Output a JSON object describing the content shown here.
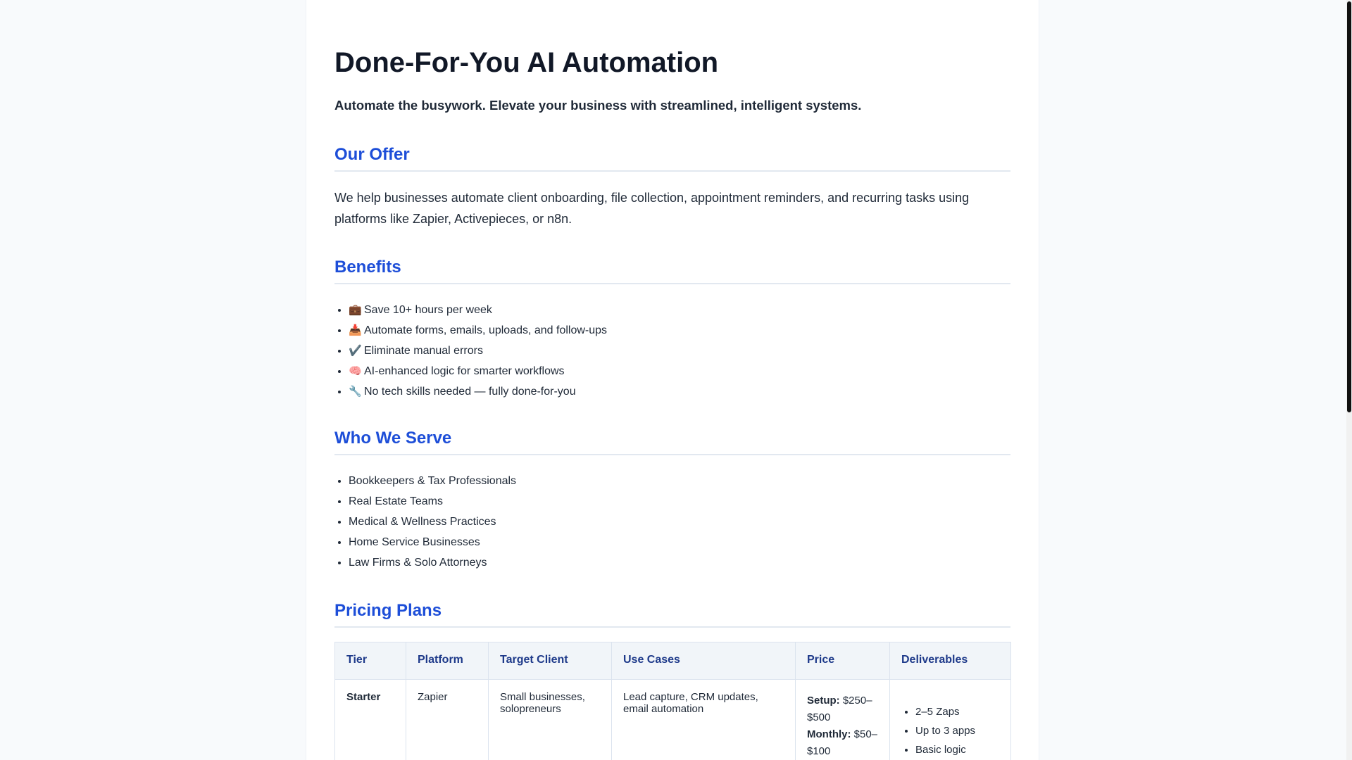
{
  "title": "Done-For-You AI Automation",
  "tagline": "Automate the busywork. Elevate your business with streamlined, intelligent systems.",
  "offer": {
    "heading": "Our Offer",
    "text": "We help businesses automate client onboarding, file collection, appointment reminders, and recurring tasks using platforms like Zapier, Activepieces, or n8n."
  },
  "benefits": {
    "heading": "Benefits",
    "items": [
      {
        "icon": "💼",
        "icon_name": "briefcase-icon",
        "text": "Save 10+ hours per week"
      },
      {
        "icon": "📥",
        "icon_name": "inbox-tray-icon",
        "text": "Automate forms, emails, uploads, and follow-ups"
      },
      {
        "icon": "✔️",
        "icon_name": "check-mark-icon",
        "text": "Eliminate manual errors"
      },
      {
        "icon": "🧠",
        "icon_name": "brain-icon",
        "text": "AI-enhanced logic for smarter workflows"
      },
      {
        "icon": "🔧",
        "icon_name": "wrench-icon",
        "text": "No tech skills needed — fully done-for-you"
      }
    ]
  },
  "serve": {
    "heading": "Who We Serve",
    "items": [
      "Bookkeepers & Tax Professionals",
      "Real Estate Teams",
      "Medical & Wellness Practices",
      "Home Service Businesses",
      "Law Firms & Solo Attorneys"
    ]
  },
  "pricing": {
    "heading": "Pricing Plans",
    "columns": [
      "Tier",
      "Platform",
      "Target Client",
      "Use Cases",
      "Price",
      "Deliverables"
    ],
    "rows": [
      {
        "tier": "Starter",
        "platform": "Zapier",
        "target": "Small businesses, solopreneurs",
        "use_cases": "Lead capture, CRM updates, email automation",
        "setup_label": "Setup:",
        "setup_value": "$250–$500",
        "monthly_label": "Monthly:",
        "monthly_value": "$50–$100",
        "deliverables": [
          "2–5 Zaps",
          "Up to 3 apps",
          "Basic logic (filters, delays)"
        ]
      }
    ]
  },
  "colors": {
    "accent": "#1d4ed8",
    "header_text": "#1e3a8a",
    "background": "#f8fafc",
    "card": "#ffffff"
  }
}
